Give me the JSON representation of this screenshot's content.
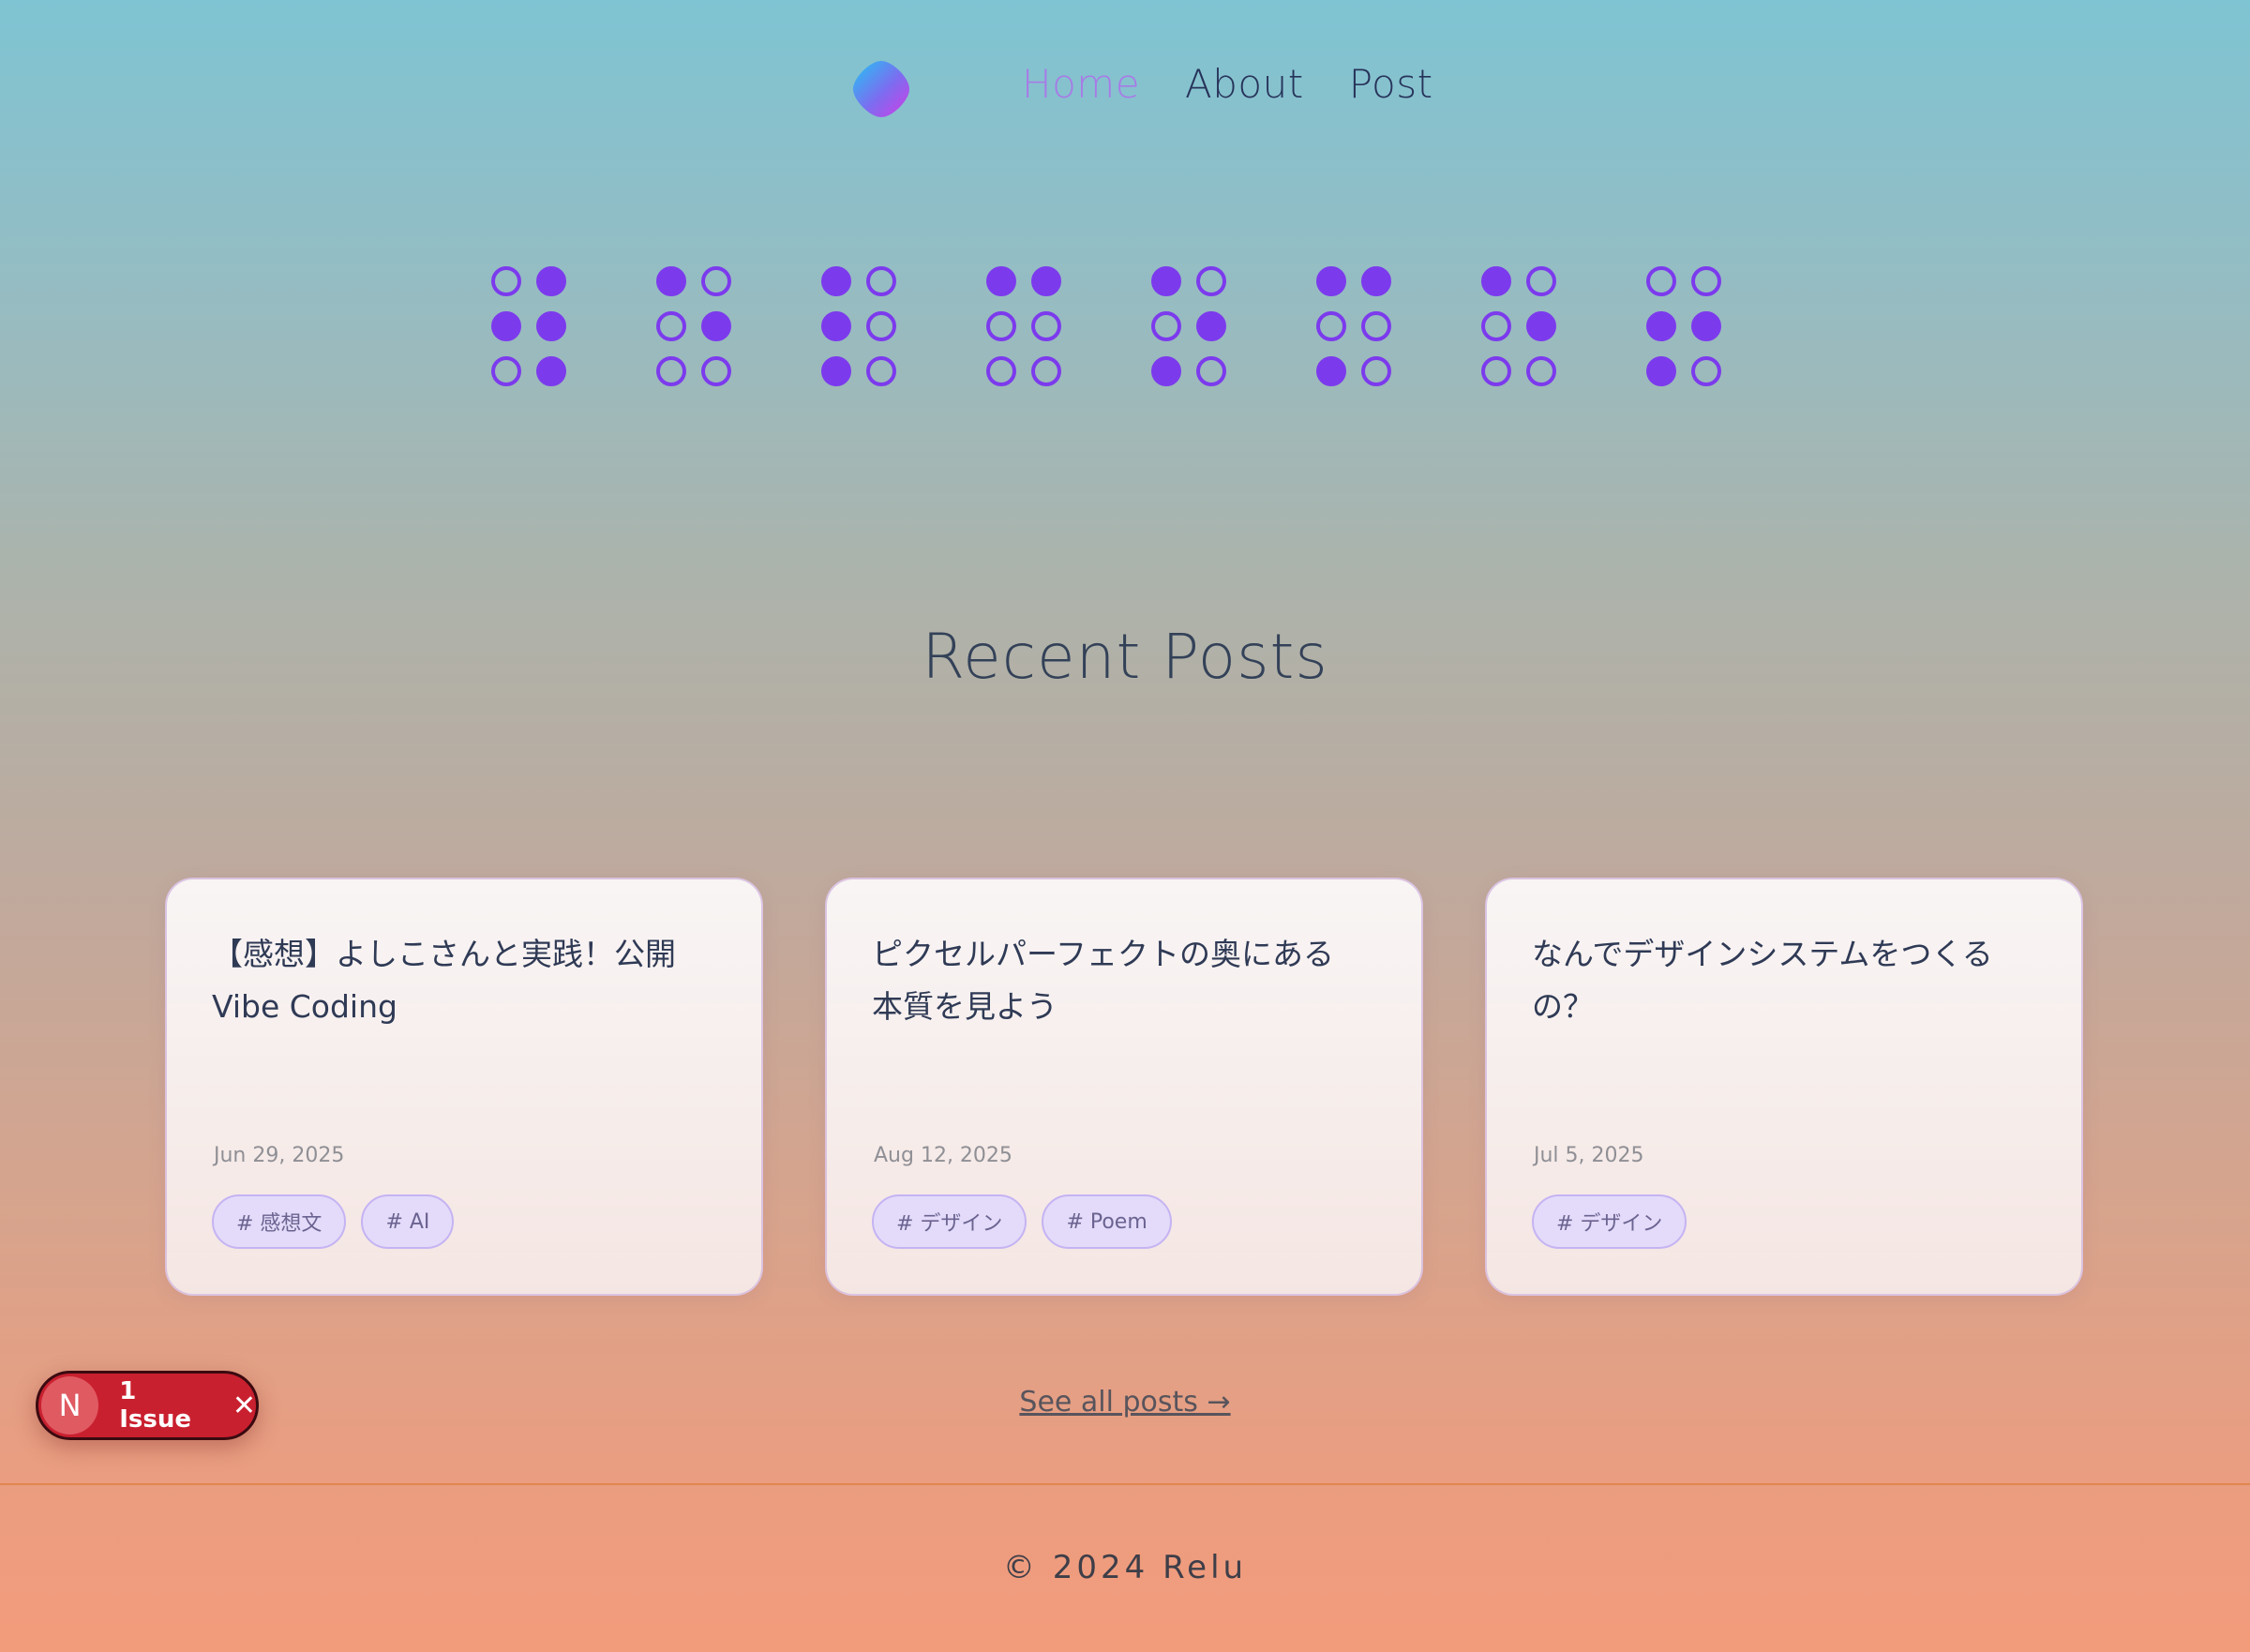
{
  "header": {
    "logo_icon": "gradient-blob-logo",
    "nav": [
      {
        "label": "Home",
        "active": true
      },
      {
        "label": "About",
        "active": false
      },
      {
        "label": "Post",
        "active": false
      }
    ]
  },
  "braille": [
    [
      0,
      1,
      1,
      1,
      0,
      1
    ],
    [
      1,
      0,
      0,
      1,
      0,
      0
    ],
    [
      1,
      0,
      1,
      0,
      1,
      0
    ],
    [
      1,
      1,
      0,
      0,
      0,
      0
    ],
    [
      1,
      0,
      0,
      1,
      1,
      0
    ],
    [
      1,
      1,
      0,
      0,
      1,
      0
    ],
    [
      1,
      0,
      0,
      1,
      0,
      0
    ],
    [
      0,
      0,
      1,
      1,
      1,
      0
    ]
  ],
  "recent": {
    "title": "Recent Posts",
    "posts": [
      {
        "title": "【感想】よしこさんと実践！公開 Vibe Coding",
        "date": "Jun 29, 2025",
        "tags": [
          "# 感想文",
          "# AI"
        ]
      },
      {
        "title": "ピクセルパーフェクトの奥にある本質を見よう",
        "date": "Aug 12, 2025",
        "tags": [
          "# デザイン",
          "# Poem"
        ]
      },
      {
        "title": "なんでデザインシステムをつくるの？",
        "date": "Jul 5, 2025",
        "tags": [
          "# デザイン"
        ]
      }
    ],
    "see_all": "See all posts →"
  },
  "issue_badge": {
    "letter": "N",
    "text": "1 Issue",
    "close": "✕"
  },
  "footer": {
    "text": "© 2024 Relu"
  },
  "colors": {
    "accent": "#7c3aed",
    "nav_active": "#a87be6",
    "issue_red": "#c9202f"
  }
}
